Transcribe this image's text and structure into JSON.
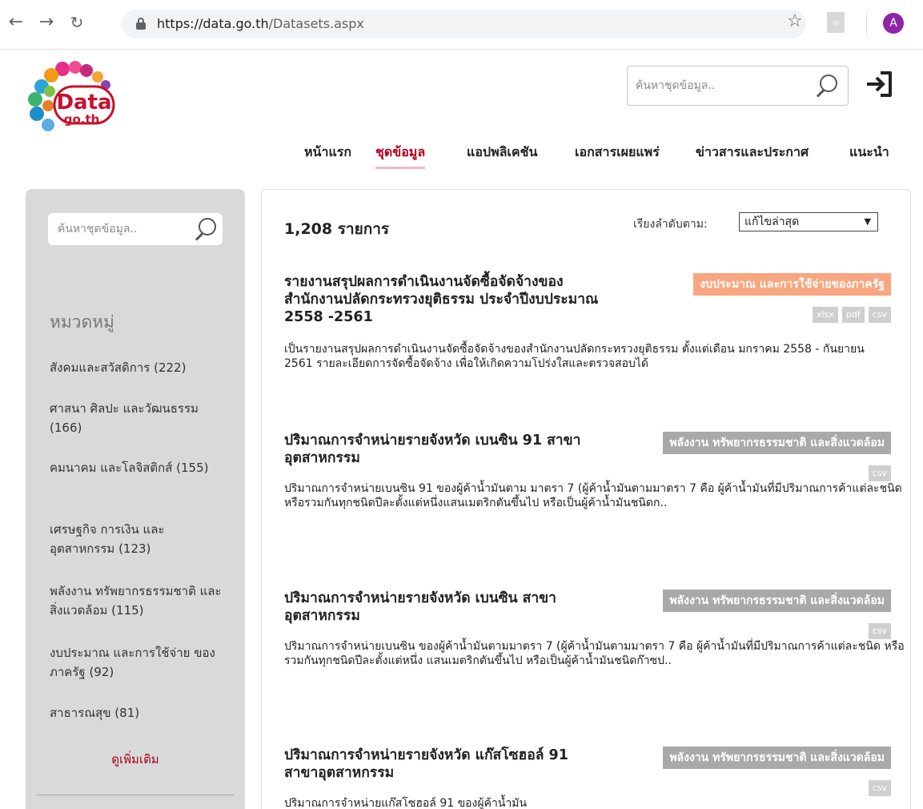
{
  "browser": {
    "url_host": "https://data.go.th",
    "url_path": "/Datasets.aspx",
    "profile_initial": "A",
    "icons": [
      "back-arrow-icon",
      "forward-arrow-icon",
      "reload-icon",
      "lock-icon",
      "star-icon",
      "pdf-extension-icon",
      "profile-avatar"
    ]
  },
  "header": {
    "logo_text": "Data",
    "logo_subtext": "go.th",
    "search_placeholder": "ค้นหาชุดข้อมูล..",
    "nav": [
      "หน้าแรก",
      "ชุดข้อมูล",
      "แอปพลิเคชัน",
      "เอกสารเผยแพร่",
      "ข่าวสารและประกาศ",
      "แนะนำ"
    ],
    "active_nav": "ชุดข้อมูล"
  },
  "sidebar": {
    "search_placeholder": "ค้นหาชุดข้อมูล..",
    "heading": "หมวดหมู่",
    "categories": [
      "สังคมและสวัสดิการ (222)",
      "ศาสนา ศิลปะ และวัฒนธรรม (166)",
      "คมนาคม และโลจิสติกส์ (155)",
      "เศรษฐกิจ การเงิน และ อุตสาหกรรม (123)",
      "พลังงาน ทรัพยากรธรรมชาติ และสิ่งแวดล้อม (115)",
      "งบประมาณ และการใช้จ่าย ของภาครัฐ (92)",
      "สาธารณสุข (81)"
    ],
    "more": "ดูเพิ่มเติม"
  },
  "results": {
    "count": "1,208 รายการ",
    "sort_label": "เรียงลำดับตาม:",
    "sort_value": "แก้ไขล่าสุด",
    "colors": {
      "budget_tag": "#f7a67f",
      "energy_tag": "#a9a9a9",
      "format_badge": "#cfcfcf",
      "active_nav": "#b0001d"
    },
    "datasets": [
      {
        "title": "รายงานสรุปผลการดำเนินงานจัดซื้อจัดจ้างของสำนักงานปลัดกระทรวงยุติธรรม ประจำปีงบประมาณ 2558 -2561",
        "category": "งบประมาณ และการใช้จ่ายของภาครัฐ",
        "formats": [
          "xlsx",
          "pdf",
          "csv"
        ],
        "description": "เป็นรายงานสรุปผลการดำเนินงานจัดซื้อจัดจ้างของสำนักงานปลัดกระทรวงยุติธรรม ตั้งแต่เดือน มกราคม 2558 - กันยายน 2561 รายละเอียดการจัดซื้อจัดจ้าง เพื่อให้เกิดความโปร่งใสและตรวจสอบได้"
      },
      {
        "title": "ปริมาณการจำหน่ายรายจังหวัด เบนซิน 91 สาขาอุตสาหกรรม",
        "category": "พลังงาน ทรัพยากรธรรมชาติ และสิ่งแวดล้อม",
        "formats": [
          "csv"
        ],
        "description": "ปริมาณการจำหน่ายเบนซิน 91 ของผู้ค้าน้ำมันตาม มาตรา 7 (ผู้ค้าน้ำมันตามมาตรา 7 คือ ผู้ค้าน้ำมันที่มีปริมาณการค้าแต่ละชนิด หรือรวมกันทุกชนิดปีละตั้งแต่หนึ่งแสนเมตริกตันขึ้นไป หรือเป็นผู้ค้าน้ำมันชนิดก.."
      },
      {
        "title": "ปริมาณการจำหน่ายรายจังหวัด เบนซิน สาขาอุตสาหกรรม",
        "category": "พลังงาน ทรัพยากรธรรมชาติ และสิ่งแวดล้อม",
        "formats": [
          "csv"
        ],
        "description": "ปริมาณการจำหน่ายเบนซิน ของผู้ค้าน้ำมันตามมาตรา 7 (ผู้ค้าน้ำมันตามมาตรา 7 คือ ผู้ค้าน้ำมันที่มีปริมาณการค้าแต่ละชนิด หรือรวมกันทุกชนิดปีละตั้งแต่หนึ่ง แสนเมตริกตันขึ้นไป หรือเป็นผู้ค้าน้ำมันชนิดก๊าซป.."
      },
      {
        "title": "ปริมาณการจำหน่ายรายจังหวัด แก๊สโซฮอล์ 91 สาขาอุตสาหกรรม",
        "category": "พลังงาน ทรัพยากรธรรมชาติ และสิ่งแวดล้อม",
        "formats": [
          "csv"
        ],
        "description": "ปริมาณการจำหน่ายแก๊สโซฮอล์ 91 ของผู้ค้าน้ำมัน"
      }
    ]
  }
}
